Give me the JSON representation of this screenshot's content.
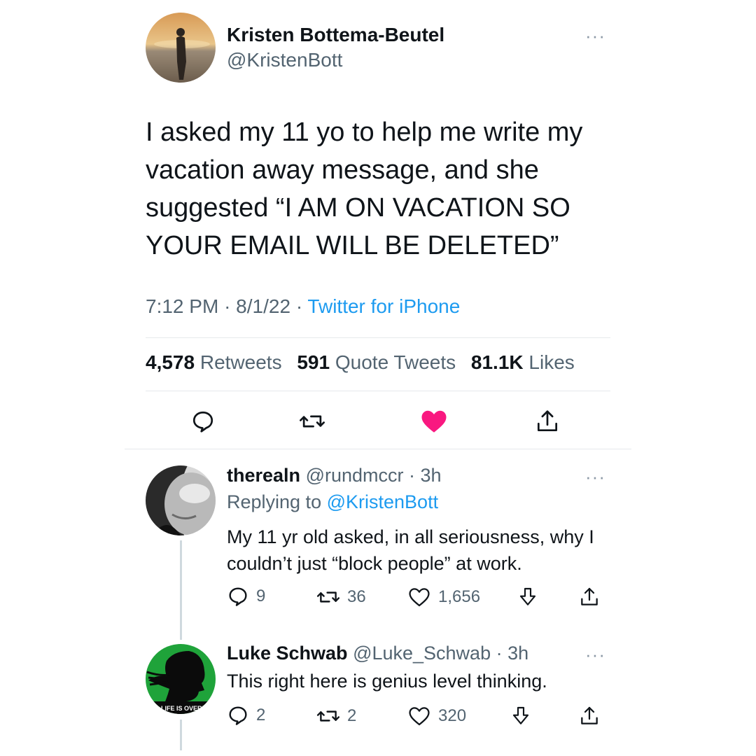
{
  "main_tweet": {
    "author_name": "Kristen Bottema-Beutel",
    "author_handle": "@KristenBott",
    "text": "I asked my 11 yo to help me write my vacation away message, and she suggested “I AM ON VACATION SO YOUR EMAIL WILL BE DELETED”",
    "time": "7:12 PM",
    "date": "8/1/22",
    "source": "Twitter for iPhone",
    "separator": "·",
    "stats": {
      "retweets_count": "4,578",
      "retweets_label": "Retweets",
      "quotes_count": "591",
      "quotes_label": "Quote Tweets",
      "likes_count": "81.1K",
      "likes_label": "Likes"
    },
    "more_icon": "···",
    "liked": true,
    "colors": {
      "like": "#f91880",
      "link": "#1d9bf0"
    }
  },
  "replies": [
    {
      "author_name": "therealn",
      "author_handle": "@rundmccr",
      "time": "3h",
      "replying_label": "Replying to",
      "replying_to": "@KristenBott",
      "text": "My 11 yr old asked, in all seriousness, why I couldn’t just “block people” at work.",
      "reply_count": "9",
      "retweet_count": "36",
      "like_count": "1,656"
    },
    {
      "author_name": "Luke Schwab",
      "author_handle": "@Luke_Schwab",
      "time": "3h",
      "text": "This right here is genius level thinking.",
      "avatar_text": "LIFE IS OVERR",
      "reply_count": "2",
      "retweet_count": "2",
      "like_count": "320"
    }
  ]
}
